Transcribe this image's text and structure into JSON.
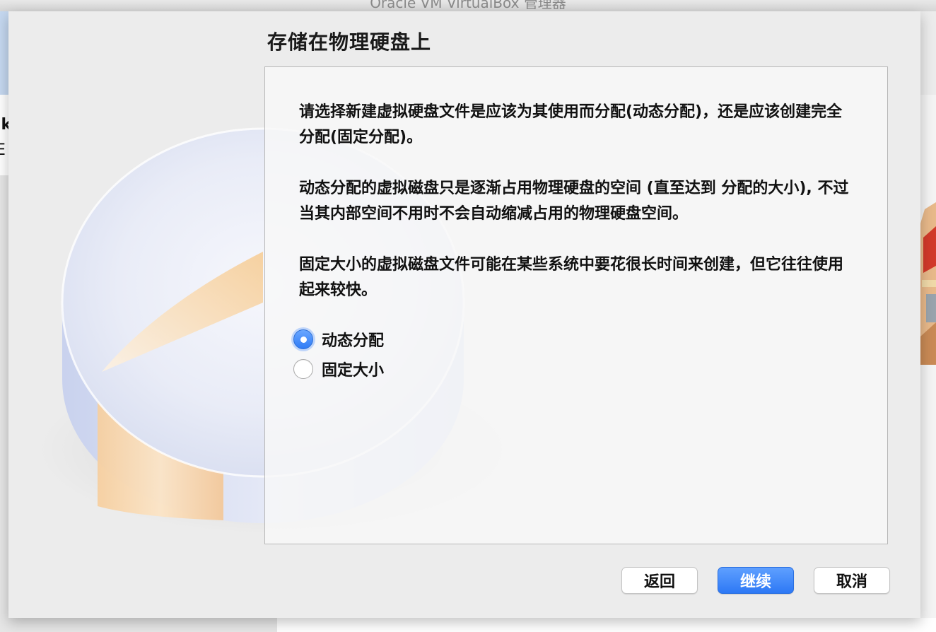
{
  "window": {
    "background_title": "Oracle VM VirtualBox 管理器",
    "left_fragment_line1": "lk",
    "left_fragment_line2": "E"
  },
  "dialog": {
    "title": "存储在物理硬盘上",
    "paragraphs": [
      "请选择新建虚拟硬盘文件是应该为其使用而分配(动态分配)，还是应该创建完全分配(固定分配)。",
      "动态分配的虚拟磁盘只是逐渐占用物理硬盘的空间 (直至达到 分配的大小), 不过当其内部空间不用时不会自动缩减占用的物理硬盘空间。",
      "固定大小的虚拟磁盘文件可能在某些系统中要花很长时间来创建，但它往往使用起来较快。"
    ],
    "options": [
      {
        "label": "动态分配",
        "selected": true
      },
      {
        "label": "固定大小",
        "selected": false
      }
    ],
    "buttons": {
      "back": "返回",
      "continue": "继续",
      "cancel": "取消"
    }
  },
  "colors": {
    "accent": "#2f7cf6",
    "dialog_bg": "#ececec",
    "content_bg": "#f8f8f8"
  }
}
